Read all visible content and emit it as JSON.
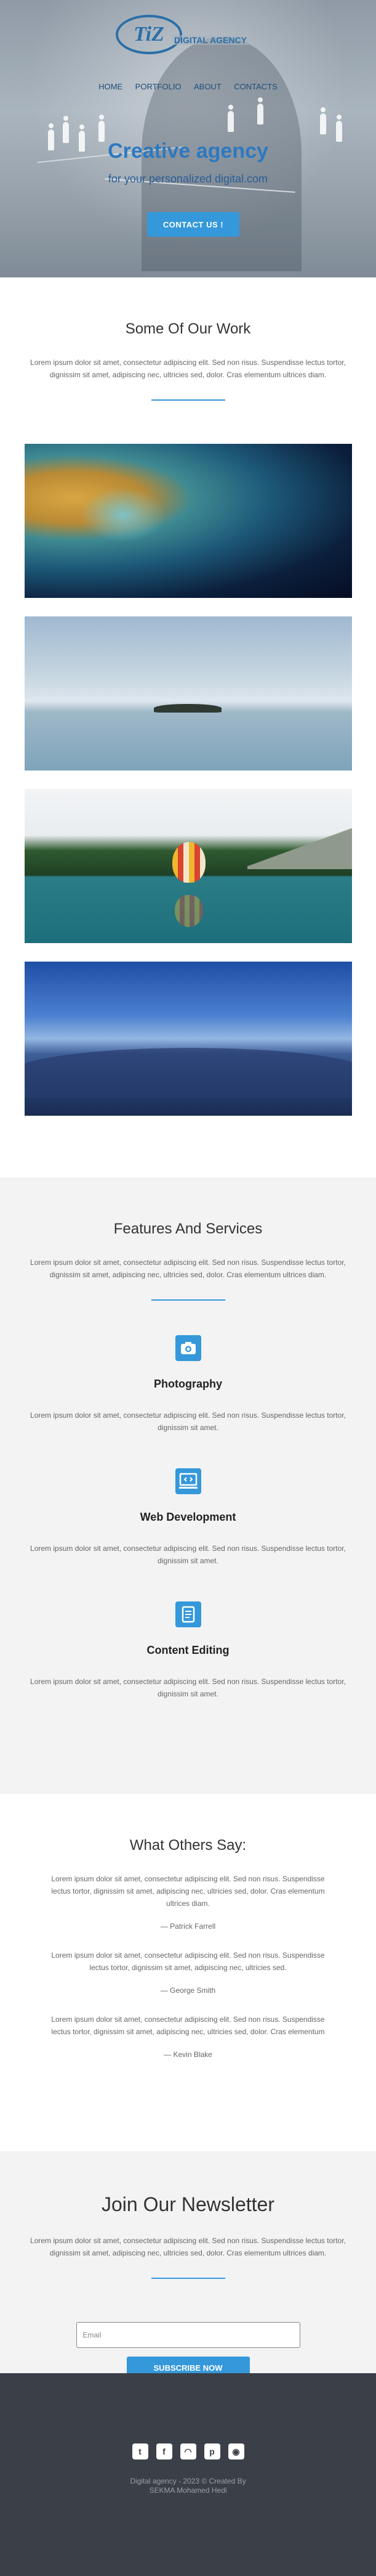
{
  "hero": {
    "logo_mark": "TiZ",
    "logo_text": "DIGITAL AGENCY",
    "nav": [
      "HOME",
      "PORTFOLIO",
      "ABOUT",
      "CONTACTS"
    ],
    "title": "Creative agency",
    "subtitle": "for your personalized digital.com",
    "cta": "CONTACT US !"
  },
  "work": {
    "title": "Some Of Our Work",
    "text": "Lorem ipsum dolor sit amet, consectetur adipiscing elit. Sed non risus. Suspendisse lectus tortor, dignissim sit amet, adipiscing nec, ultricies sed, dolor. Cras elementum ultrices diam."
  },
  "features": {
    "title": "Features And Services",
    "text": "Lorem ipsum dolor sit amet, consectetur adipiscing elit. Sed non risus. Suspendisse lectus tortor, dignissim sit amet, adipiscing nec, ultricies sed, dolor. Cras elementum ultrices diam.",
    "items": [
      {
        "icon": "camera-icon",
        "title": "Photography",
        "text": "Lorem ipsum dolor sit amet, consectetur adipiscing elit. Sed non risus. Suspendisse lectus tortor, dignissim sit amet."
      },
      {
        "icon": "monitor-code-icon",
        "title": "Web Development",
        "text": "Lorem ipsum dolor sit amet, consectetur adipiscing elit. Sed non risus. Suspendisse lectus tortor, dignissim sit amet."
      },
      {
        "icon": "document-edit-icon",
        "title": "Content Editing",
        "text": "Lorem ipsum dolor sit amet, consectetur adipiscing elit. Sed non risus. Suspendisse lectus tortor, dignissim sit amet."
      }
    ]
  },
  "testimonials": {
    "title": "What Others Say:",
    "items": [
      {
        "text": "Lorem ipsum dolor sit amet, consectetur adipiscing elit. Sed non risus. Suspendisse lectus tortor, dignissim sit amet, adipiscing nec, ultricies sed, dolor. Cras elementum ultrices diam.",
        "author": "— Patrick Farrell"
      },
      {
        "text": "Lorem ipsum dolor sit amet, consectetur adipiscing elit. Sed non risus. Suspendisse lectus tortor, dignissim sit amet, adipiscing nec, ultricies sed.",
        "author": "— George Smith"
      },
      {
        "text": "Lorem ipsum dolor sit amet, consectetur adipiscing elit. Sed non risus. Suspendisse lectus tortor, dignissim sit amet, adipiscing nec, ultricies sed, dolor. Cras elementum",
        "author": "— Kevin Blake"
      }
    ]
  },
  "newsletter": {
    "title": "Join Our Newsletter",
    "text": "Lorem ipsum dolor sit amet, consectetur adipiscing elit. Sed non risus. Suspendisse lectus tortor, dignissim sit amet, adipiscing nec, ultricies sed, dolor. Cras elementum ultrices diam.",
    "email_placeholder": "Email",
    "button": "SUBSCRIBE NOW"
  },
  "footer": {
    "socials": [
      {
        "name": "twitter-icon",
        "glyph": "t"
      },
      {
        "name": "facebook-icon",
        "glyph": "f"
      },
      {
        "name": "snapchat-icon",
        "glyph": "◠"
      },
      {
        "name": "pinterest-icon",
        "glyph": "p"
      },
      {
        "name": "github-icon",
        "glyph": "◉"
      }
    ],
    "copy_line1": "Digital agency - 2023 © Created By",
    "copy_line2": "SEKMA Mohamed Hedi"
  },
  "colors": {
    "accent": "#3498db",
    "footer_bg": "#3b3f47",
    "section_bg": "#f3f3f3"
  }
}
